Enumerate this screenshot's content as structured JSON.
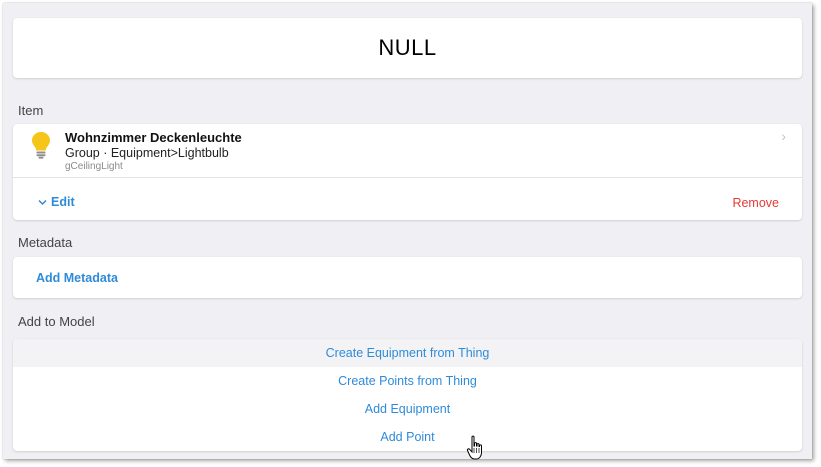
{
  "state": {
    "value": "NULL"
  },
  "item_section": {
    "title": "Item",
    "item": {
      "name": "Wohnzimmer Deckenleuchte",
      "type_line": "Group · Equipment>Lightbulb",
      "id": "gCeilingLight",
      "icon": "lightbulb-icon",
      "icon_color": "#f5c518"
    },
    "edit_label": "Edit",
    "remove_label": "Remove"
  },
  "metadata_section": {
    "title": "Metadata",
    "add_label": "Add Metadata"
  },
  "model_section": {
    "title": "Add to Model",
    "actions": [
      "Create Equipment from Thing",
      "Create Points from Thing",
      "Add Equipment",
      "Add Point"
    ]
  },
  "colors": {
    "accent": "#2f8bd8",
    "danger": "#e53935",
    "background": "#efeff4"
  }
}
